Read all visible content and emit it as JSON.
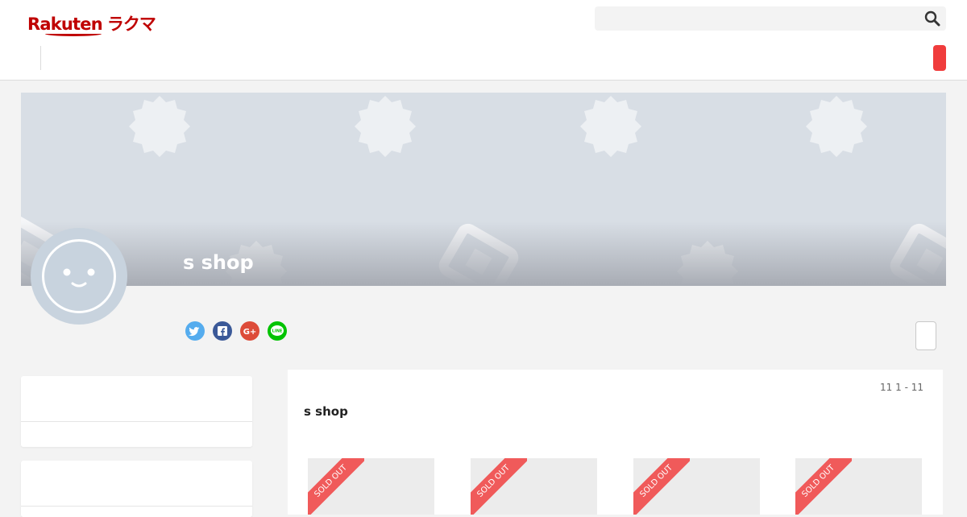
{
  "header": {
    "logo_main": "Rakuten",
    "logo_kana": "ラクマ",
    "search": {
      "placeholder": "",
      "icon": "search-icon"
    },
    "accent_color": "#bf0000",
    "button_color": "#f03c3c"
  },
  "profile": {
    "shop_name": "s shop",
    "avatar_icon": "smiley-face-icon",
    "social": [
      {
        "name": "twitter",
        "color": "#55acee",
        "glyph": "🐦"
      },
      {
        "name": "facebook",
        "color": "#3b5998",
        "glyph": "f"
      },
      {
        "name": "google-plus",
        "color": "#dd4b39",
        "glyph": "G+"
      },
      {
        "name": "line",
        "color": "#00c300",
        "glyph": "LINE"
      }
    ]
  },
  "main": {
    "count_text": "11 1 - 11",
    "title": "s shop",
    "items": [
      {
        "badge": "SOLD OUT"
      },
      {
        "badge": "SOLD OUT"
      },
      {
        "badge": "SOLD OUT"
      },
      {
        "badge": "SOLD OUT"
      }
    ]
  }
}
